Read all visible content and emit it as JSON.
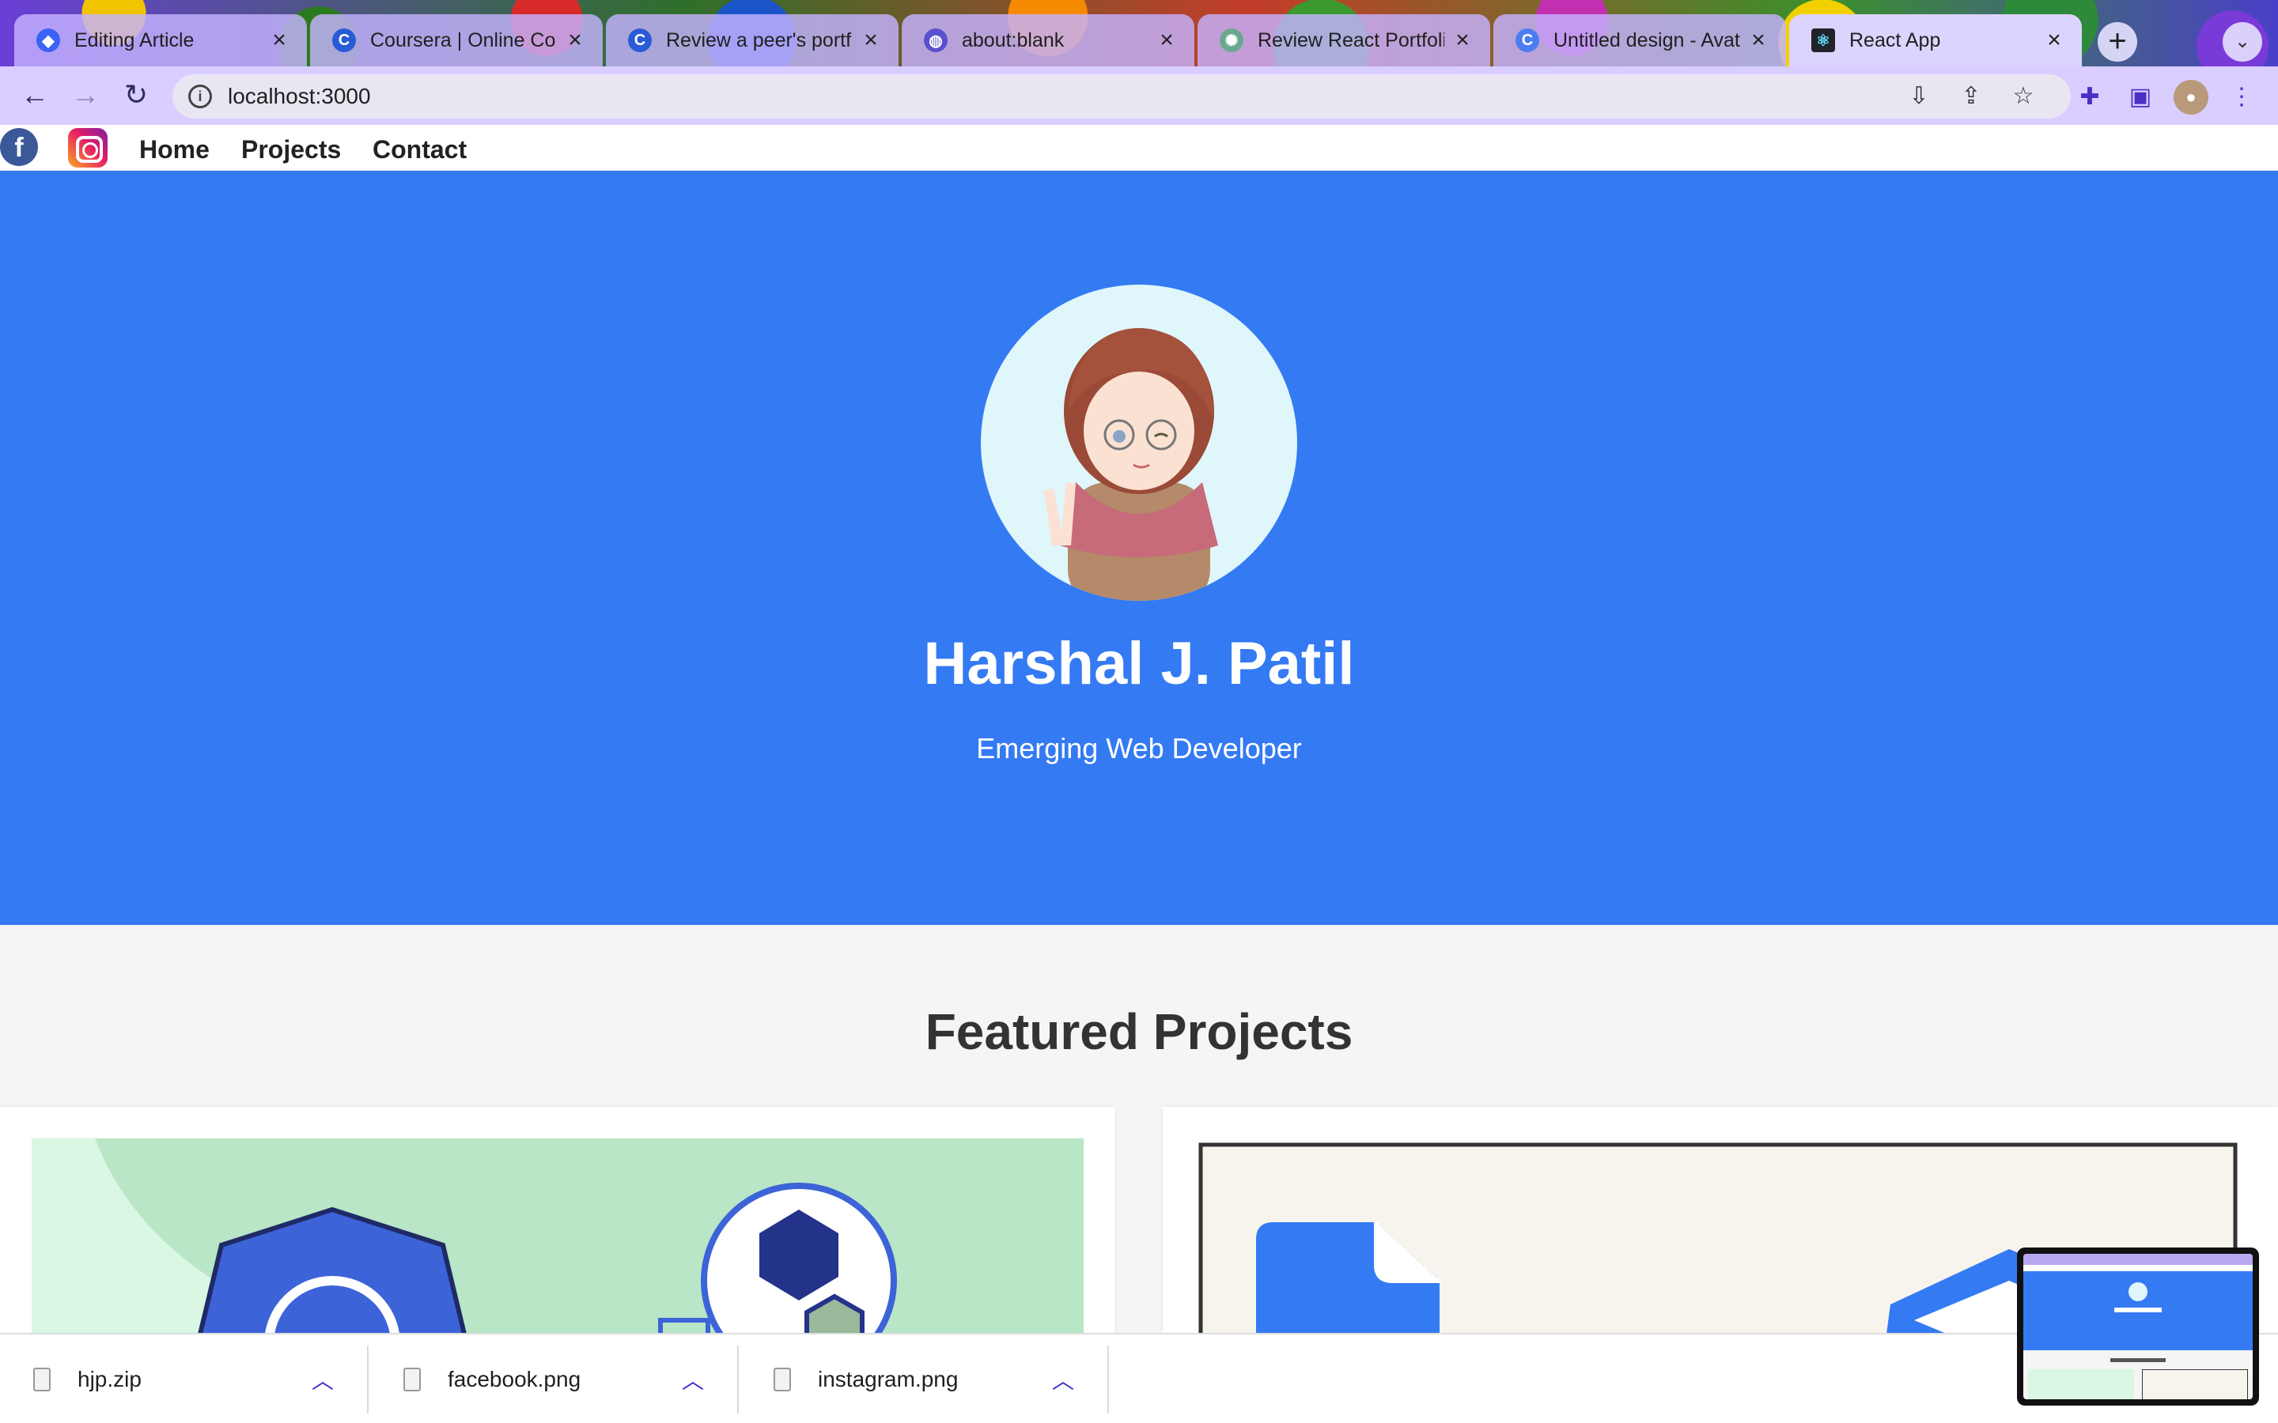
{
  "browser": {
    "tabs": [
      {
        "title": "Editing Article",
        "favicon": "hashnode-icon"
      },
      {
        "title": "Coursera | Online Cou",
        "favicon": "coursera-icon"
      },
      {
        "title": "Review a peer's portf",
        "favicon": "coursera-icon"
      },
      {
        "title": "about:blank",
        "favicon": "globe-icon"
      },
      {
        "title": "Review React Portfoli",
        "favicon": "chatgpt-icon"
      },
      {
        "title": "Untitled design - Avat",
        "favicon": "canva-icon"
      },
      {
        "title": "React App",
        "favicon": "react-icon"
      }
    ],
    "active_tab": 6,
    "url": "localhost:3000"
  },
  "site": {
    "nav": {
      "home": "Home",
      "projects": "Projects",
      "contact": "Contact"
    },
    "hero": {
      "name": "Harshal J. Patil",
      "tagline": "Emerging Web Developer"
    },
    "projects_title": "Featured Projects"
  },
  "downloads": [
    {
      "filename": "hjp.zip"
    },
    {
      "filename": "facebook.png"
    },
    {
      "filename": "instagram.png"
    }
  ],
  "colors": {
    "hero_bg": "#347af3",
    "page_bg": "#f5f5f5",
    "facebook": "#3b5998"
  }
}
